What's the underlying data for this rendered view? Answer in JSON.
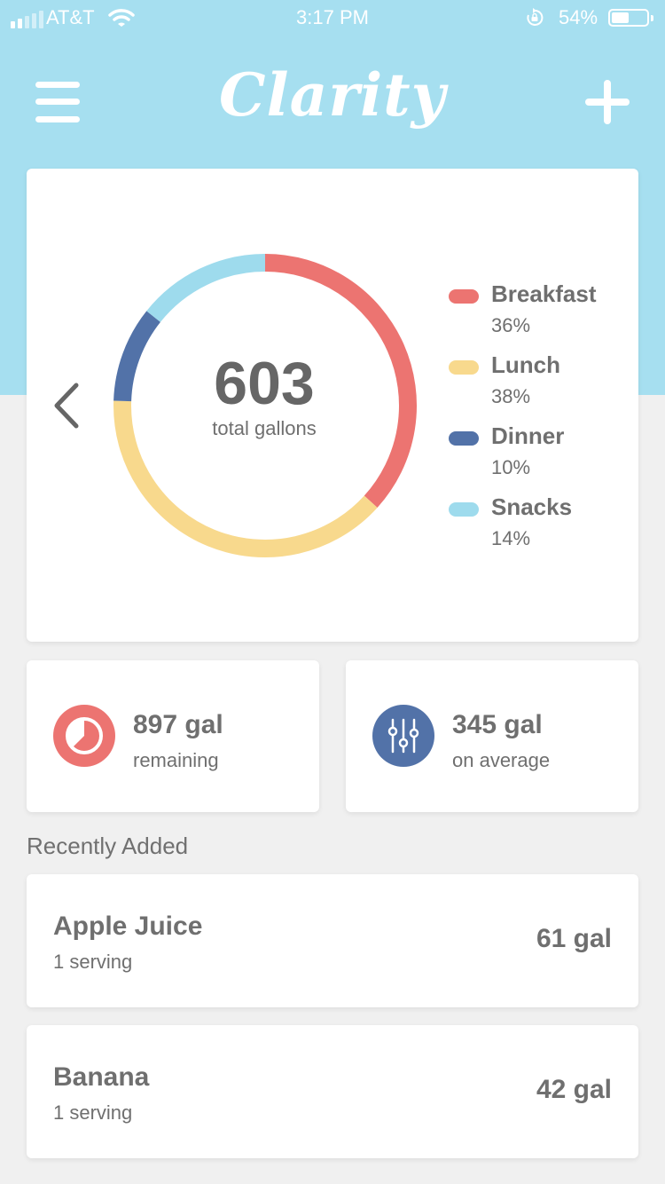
{
  "status_bar": {
    "carrier": "AT&T",
    "time": "3:17 PM",
    "battery_percent": "54%",
    "battery_level": 0.54,
    "signal_bars": 2,
    "icons": [
      "signal-icon",
      "wifi-icon",
      "rotation-lock-icon",
      "battery-icon"
    ]
  },
  "header": {
    "title": "Clarity",
    "menu_icon": "hamburger-menu-icon",
    "add_icon": "plus-icon",
    "background_color": "#a6dff0"
  },
  "summary": {
    "total_value": "603",
    "total_label": "total gallons",
    "prev_icon": "chevron-left-icon",
    "legend": [
      {
        "name": "Breakfast",
        "percent_label": "36%",
        "color": "#ec7471"
      },
      {
        "name": "Lunch",
        "percent_label": "38%",
        "color": "#f8d98d"
      },
      {
        "name": "Dinner",
        "percent_label": "10%",
        "color": "#5272a8"
      },
      {
        "name": "Snacks",
        "percent_label": "14%",
        "color": "#9edbed"
      }
    ]
  },
  "chart_data": {
    "type": "pie",
    "categories": [
      "Breakfast",
      "Lunch",
      "Dinner",
      "Snacks"
    ],
    "values": [
      36,
      38,
      10,
      14
    ],
    "colors": [
      "#ec7471",
      "#f8d98d",
      "#5272a8",
      "#9edbed"
    ],
    "title": "",
    "style": "donut",
    "legend": "right"
  },
  "stats": [
    {
      "value": "897 gal",
      "label": "remaining",
      "icon": "timer-icon",
      "color": "#ec7471"
    },
    {
      "value": "345 gal",
      "label": "on average",
      "icon": "sliders-icon",
      "color": "#5272a8"
    }
  ],
  "recent": {
    "title": "Recently Added",
    "items": [
      {
        "name": "Apple Juice",
        "serving": "1 serving",
        "amount": "61 gal"
      },
      {
        "name": "Banana",
        "serving": "1 serving",
        "amount": "42 gal"
      }
    ]
  }
}
